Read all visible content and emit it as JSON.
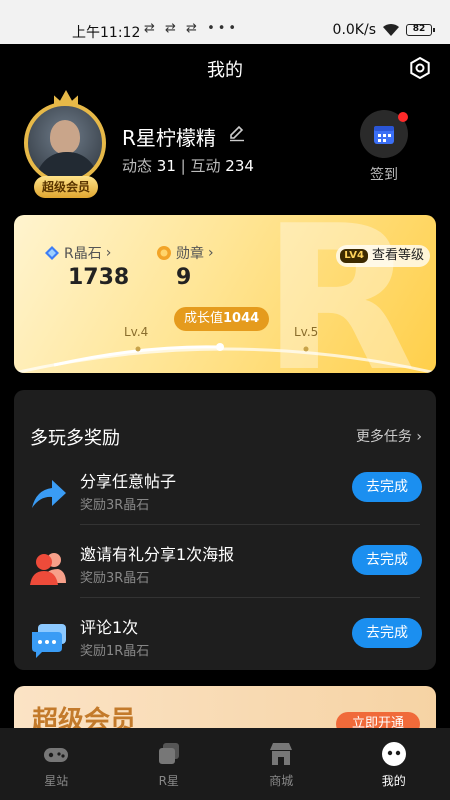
{
  "status_bar": {
    "time": "上午11:12",
    "network_speed": "0.0K/s",
    "battery": "82"
  },
  "header": {
    "title": "我的"
  },
  "profile": {
    "username": "R星柠檬精",
    "badge": "超级会员",
    "stats": {
      "posts_label": "动态",
      "posts_value": "31",
      "interactions_label": "互动",
      "interactions_value": "234"
    },
    "checkin_label": "签到"
  },
  "level_card": {
    "crystal_label": "R晶石",
    "crystal_value": "1738",
    "medal_label": "勋章",
    "medal_value": "9",
    "level_tag": "LV4",
    "view_level": "查看等级",
    "growth_label": "成长值",
    "growth_value": "1044",
    "current_level": "Lv.4",
    "next_level": "Lv.5"
  },
  "tasks": {
    "title": "多玩多奖励",
    "more": "更多任务",
    "items": [
      {
        "name": "分享任意帖子",
        "reward": "奖励3R晶石",
        "button": "去完成",
        "icon": "share-icon"
      },
      {
        "name": "邀请有礼分享1次海报",
        "reward": "奖励3R晶石",
        "button": "去完成",
        "icon": "invite-icon"
      },
      {
        "name": "评论1次",
        "reward": "奖励1R晶石",
        "button": "去完成",
        "icon": "comment-icon"
      }
    ]
  },
  "vip_banner": {
    "title": "超级会员",
    "button": "立即开通"
  },
  "bottom_nav": [
    {
      "label": "星站",
      "icon": "game-icon",
      "active": false
    },
    {
      "label": "R星",
      "icon": "chat-icon",
      "active": false
    },
    {
      "label": "商城",
      "icon": "shop-icon",
      "active": false
    },
    {
      "label": "我的",
      "icon": "profile-icon",
      "active": true
    }
  ],
  "colors": {
    "accent": "#1b8ff0",
    "gold": "#e7b948",
    "background": "#000000"
  }
}
